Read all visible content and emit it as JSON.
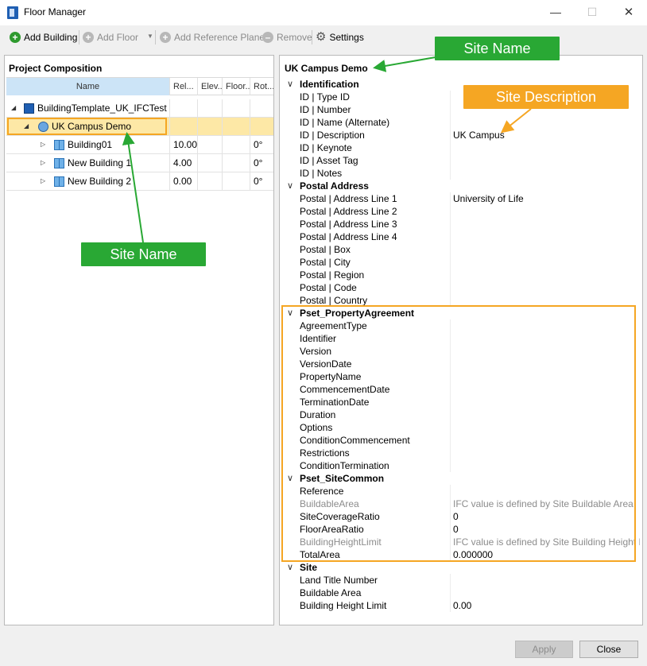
{
  "window": {
    "title": "Floor Manager"
  },
  "toolbar": {
    "add_building": "Add Building",
    "add_floor": "Add Floor",
    "add_reference_plane": "Add Reference Plane",
    "remove": "Remove",
    "settings": "Settings"
  },
  "left_panel": {
    "title": "Project Composition",
    "columns": [
      "Name",
      "Rel...",
      "Elev...",
      "Floor...",
      "Rot..."
    ],
    "rows": [
      {
        "name": "BuildingTemplate_UK_IFCTest",
        "rel": "",
        "elev": "",
        "floor": "",
        "rot": ""
      },
      {
        "name": "UK Campus Demo",
        "rel": "",
        "elev": "",
        "floor": "",
        "rot": ""
      },
      {
        "name": "Building01",
        "rel": "10.00",
        "elev": "",
        "floor": "",
        "rot": "0°"
      },
      {
        "name": "New Building 1",
        "rel": "4.00",
        "elev": "",
        "floor": "",
        "rot": "0°"
      },
      {
        "name": "New Building 2",
        "rel": "0.00",
        "elev": "",
        "floor": "",
        "rot": "0°"
      }
    ]
  },
  "right_panel": {
    "title": "UK Campus Demo",
    "categories": [
      {
        "name": "Identification",
        "props": [
          {
            "name": "ID | Type ID",
            "value": ""
          },
          {
            "name": "ID | Number",
            "value": ""
          },
          {
            "name": "ID | Name (Alternate)",
            "value": ""
          },
          {
            "name": "ID | Description",
            "value": "UK Campus"
          },
          {
            "name": "ID | Keynote",
            "value": ""
          },
          {
            "name": "ID | Asset Tag",
            "value": ""
          },
          {
            "name": "ID | Notes",
            "value": ""
          }
        ]
      },
      {
        "name": "Postal Address",
        "props": [
          {
            "name": "Postal | Address Line 1",
            "value": "University of Life"
          },
          {
            "name": "Postal | Address Line 2",
            "value": ""
          },
          {
            "name": "Postal | Address Line 3",
            "value": ""
          },
          {
            "name": "Postal | Address Line 4",
            "value": ""
          },
          {
            "name": "Postal | Box",
            "value": ""
          },
          {
            "name": "Postal | City",
            "value": ""
          },
          {
            "name": "Postal | Region",
            "value": ""
          },
          {
            "name": "Postal | Code",
            "value": ""
          },
          {
            "name": "Postal | Country",
            "value": ""
          }
        ]
      },
      {
        "name": "Pset_PropertyAgreement",
        "props": [
          {
            "name": "AgreementType",
            "value": ""
          },
          {
            "name": "Identifier",
            "value": ""
          },
          {
            "name": "Version",
            "value": ""
          },
          {
            "name": "VersionDate",
            "value": ""
          },
          {
            "name": "PropertyName",
            "value": ""
          },
          {
            "name": "CommencementDate",
            "value": ""
          },
          {
            "name": "TerminationDate",
            "value": ""
          },
          {
            "name": "Duration",
            "value": ""
          },
          {
            "name": "Options",
            "value": ""
          },
          {
            "name": "ConditionCommencement",
            "value": ""
          },
          {
            "name": "Restrictions",
            "value": ""
          },
          {
            "name": "ConditionTermination",
            "value": ""
          }
        ]
      },
      {
        "name": "Pset_SiteCommon",
        "props": [
          {
            "name": "Reference",
            "value": ""
          },
          {
            "name": "BuildableArea",
            "value": "IFC value is defined by Site Buildable Area",
            "disabled": true
          },
          {
            "name": "SiteCoverageRatio",
            "value": "0"
          },
          {
            "name": "FloorAreaRatio",
            "value": "0"
          },
          {
            "name": "BuildingHeightLimit",
            "value": "IFC value is defined by Site Building Height Limit",
            "disabled": true
          },
          {
            "name": "TotalArea",
            "value": "0.000000"
          }
        ]
      },
      {
        "name": "Site",
        "props": [
          {
            "name": "Land Title Number",
            "value": ""
          },
          {
            "name": "Buildable Area",
            "value": ""
          },
          {
            "name": "Building Height Limit",
            "value": "0.00"
          }
        ]
      }
    ]
  },
  "annotations": {
    "site_name_top": "Site Name",
    "site_description": "Site Description",
    "site_name_left": "Site Name"
  },
  "footer": {
    "apply": "Apply",
    "close": "Close"
  },
  "colors": {
    "callout_green": "#29a834",
    "callout_orange": "#f5a623",
    "selection": "#fde8a6"
  }
}
